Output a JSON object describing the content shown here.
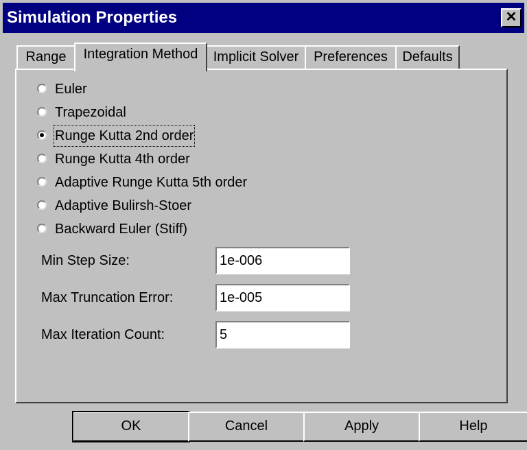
{
  "window": {
    "title": "Simulation Properties",
    "close_glyph": "✕"
  },
  "tabs": [
    {
      "label": "Range"
    },
    {
      "label": "Integration Method"
    },
    {
      "label": "Implicit Solver"
    },
    {
      "label": "Preferences"
    },
    {
      "label": "Defaults"
    }
  ],
  "active_tab": "Integration Method",
  "methods": [
    {
      "label": "Euler"
    },
    {
      "label": "Trapezoidal"
    },
    {
      "label": "Runge Kutta 2nd order"
    },
    {
      "label": "Runge Kutta 4th order"
    },
    {
      "label": "Adaptive Runge Kutta 5th order"
    },
    {
      "label": "Adaptive Bulirsh-Stoer"
    },
    {
      "label": "Backward Euler (Stiff)"
    }
  ],
  "selected_method": "Runge Kutta 2nd order",
  "fields": {
    "min_step": {
      "label": "Min Step Size:",
      "value": "1e-006"
    },
    "max_trunc": {
      "label": "Max Truncation Error:",
      "value": "1e-005"
    },
    "max_iter": {
      "label": "Max Iteration Count:",
      "value": "5"
    }
  },
  "buttons": {
    "ok": "OK",
    "cancel": "Cancel",
    "apply": "Apply",
    "help": "Help"
  },
  "colors": {
    "title_bar": "#000080",
    "face": "#c0c0c0"
  }
}
